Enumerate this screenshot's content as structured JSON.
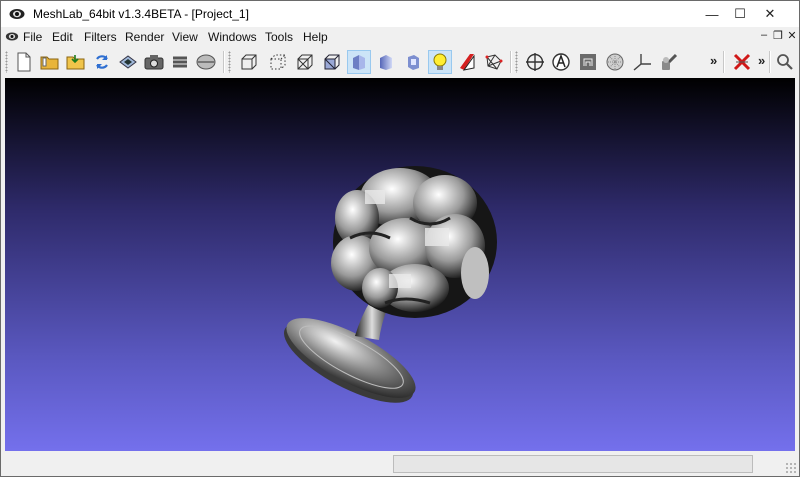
{
  "window": {
    "title": "MeshLab_64bit v1.3.4BETA - [Project_1]",
    "minimize_glyph": "—",
    "maximize_glyph": "☐",
    "close_glyph": "✕"
  },
  "menubar": {
    "items": [
      {
        "label": "File"
      },
      {
        "label": "Edit"
      },
      {
        "label": "Filters"
      },
      {
        "label": "Render"
      },
      {
        "label": "View"
      },
      {
        "label": "Windows"
      },
      {
        "label": "Tools"
      },
      {
        "label": "Help"
      }
    ],
    "mdi_minimize_glyph": "–",
    "mdi_restore_glyph": "❐",
    "mdi_close_glyph": "✕"
  },
  "toolbar": {
    "overflow_glyph": "»",
    "buttons": [
      {
        "name": "new-project",
        "icon": "new-document-icon"
      },
      {
        "name": "open-project",
        "icon": "open-folder-icon"
      },
      {
        "name": "import-mesh",
        "icon": "import-folder-icon"
      },
      {
        "name": "reload",
        "icon": "reload-icon"
      },
      {
        "name": "export-mesh",
        "icon": "export-icon"
      },
      {
        "name": "snapshot",
        "icon": "camera-icon"
      },
      {
        "name": "layers",
        "icon": "layers-icon"
      },
      {
        "name": "disk",
        "icon": "disk-icon"
      },
      {
        "name": "bounding-box",
        "icon": "bounding-box-icon"
      },
      {
        "name": "points",
        "icon": "points-icon"
      },
      {
        "name": "wireframe",
        "icon": "wireframe-icon"
      },
      {
        "name": "hidden-lines",
        "icon": "hidden-lines-icon"
      },
      {
        "name": "flat-shading",
        "icon": "flat-shading-icon",
        "active": true
      },
      {
        "name": "smooth-shading",
        "icon": "smooth-shading-icon"
      },
      {
        "name": "texture",
        "icon": "texture-icon"
      },
      {
        "name": "lighting",
        "icon": "light-bulb-icon",
        "active": true
      },
      {
        "name": "double-side",
        "icon": "double-side-icon"
      },
      {
        "name": "selected-faces",
        "icon": "selected-faces-icon"
      },
      {
        "name": "manipulator",
        "icon": "crosshair-sphere-icon"
      },
      {
        "name": "annotations",
        "icon": "annotation-icon"
      },
      {
        "name": "raster",
        "icon": "raster-icon"
      },
      {
        "name": "sphere-texture",
        "icon": "sphere-texture-icon"
      },
      {
        "name": "measure",
        "icon": "measure-icon"
      },
      {
        "name": "paint",
        "icon": "paint-icon"
      },
      {
        "name": "delete-selection",
        "icon": "delete-x-icon"
      },
      {
        "name": "zoom",
        "icon": "magnifier-icon"
      }
    ]
  },
  "colors": {
    "viewport_top": "#000000",
    "viewport_bottom": "#7470ec",
    "active_button": "#cce4f7"
  },
  "statusbar": {
    "text": "",
    "progress_fraction": 0
  }
}
